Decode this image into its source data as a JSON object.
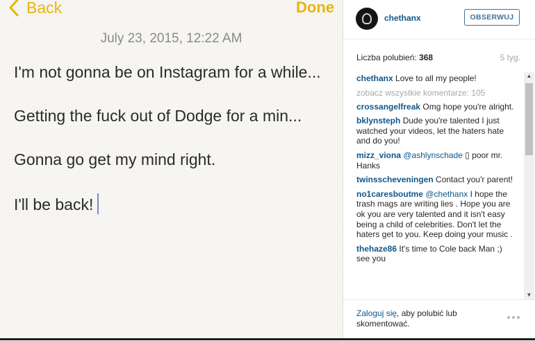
{
  "notes": {
    "back_label": "Back",
    "done_label": "Done",
    "date": "July 23, 2015, 12:22 AM",
    "lines": [
      "I'm not gonna be on Instagram for a while...",
      "Getting the fuck out of Dodge for a min...",
      "Gonna go get my mind right.",
      "I'll be back!"
    ],
    "accent_color": "#e8b50e"
  },
  "instagram": {
    "username": "chethanx",
    "follow_label": "OBSERWUJ",
    "likes_label": "Liczba polubień:",
    "likes_count": "368",
    "age": "5 tyg.",
    "view_all": "zobacz wszystkie komentarze: 105",
    "comments": [
      {
        "user": "chethanx",
        "mention": "",
        "text": "Love to all my people!"
      },
      {
        "user": "crossangelfreak",
        "mention": "",
        "text": "Omg hope you're alright."
      },
      {
        "user": "bklynsteph",
        "mention": "",
        "text": "Dude you're talented I just watched your videos, let the haters hate and do you!"
      },
      {
        "user": "mizz_viona",
        "mention": "@ashlynschade",
        "text": "▯ poor mr. Hanks"
      },
      {
        "user": "twinsscheveningen",
        "mention": "",
        "text": "Contact you'r parent!"
      },
      {
        "user": "no1caresboutme",
        "mention": "@chethanx",
        "text": "I hope the trash mags are writing lies . Hope you are ok you are very talented and it isn't easy being a child of celebrities. Don't let the haters get to you. Keep doing your music ."
      },
      {
        "user": "thehaze86",
        "mention": "",
        "text": "It's time to Cole back Man ;) see you"
      }
    ],
    "login_link": "Zaloguj się",
    "login_rest": ", aby polubić lub skomentować.",
    "link_color": "#125688"
  }
}
